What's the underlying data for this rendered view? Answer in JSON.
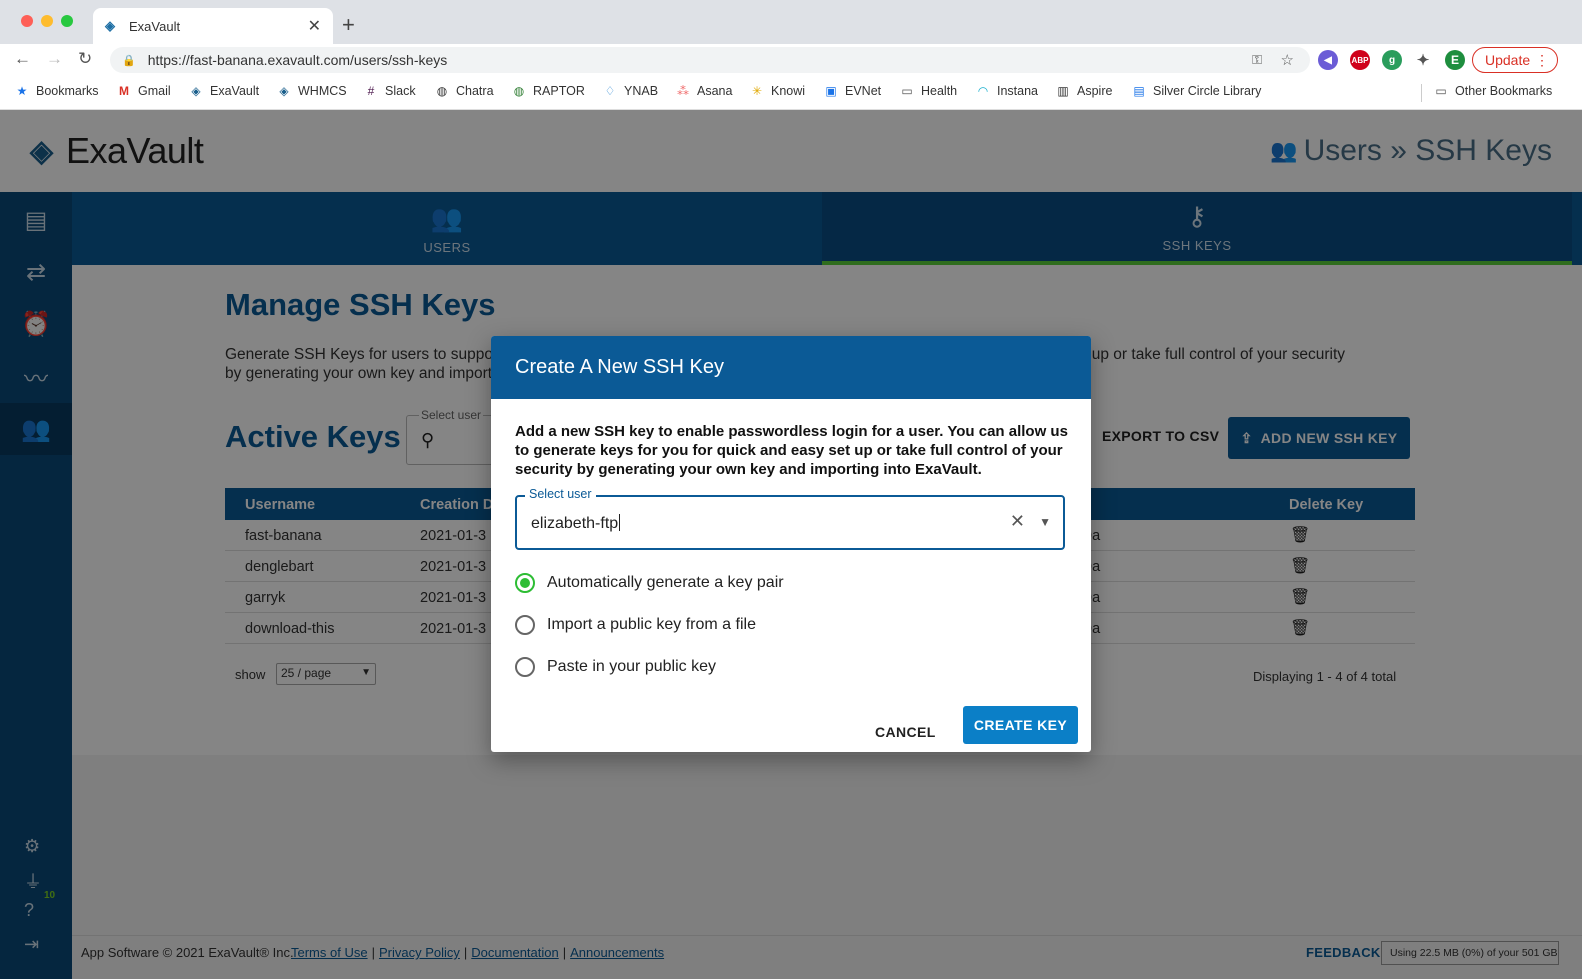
{
  "browser": {
    "tab_title": "ExaVault",
    "url": "https://fast-banana.exavault.com/users/ssh-keys",
    "update_label": "Update",
    "profile_initial": "E",
    "bookmarks": [
      "Bookmarks",
      "Gmail",
      "ExaVault",
      "WHMCS",
      "Slack",
      "Chatra",
      "RAPTOR",
      "YNAB",
      "Asana",
      "Knowi",
      "EVNet",
      "Health",
      "Instana",
      "Aspire",
      "Silver Circle Library"
    ],
    "other_bookmarks": "Other Bookmarks"
  },
  "app": {
    "logo_text": "ExaVault",
    "page_crumb": "Users » SSH Keys"
  },
  "topnav": {
    "users_label": "USERS",
    "sshkeys_label": "SSH KEYS"
  },
  "sidebar": {
    "badge": "10"
  },
  "main": {
    "manage_title": "Manage SSH Keys",
    "manage_desc": "Generate SSH Keys for users to support passwordless login. You can allow us to generate keys for you for quick and easy set up or take full control of your security by generating your own key and importing into ExaVault.",
    "active_title": "Active Keys",
    "search_label": "Select user",
    "export_label": "EXPORT TO CSV",
    "add_key_label": "ADD NEW SSH KEY",
    "table": {
      "headers": [
        "Username",
        "Creation D",
        "Delete Key"
      ],
      "rows": [
        {
          "username": "fast-banana",
          "created": "2021-01-3",
          "fingerprint": ":9a"
        },
        {
          "username": "denglebart",
          "created": "2021-01-3",
          "fingerprint": ":9a"
        },
        {
          "username": "garryk",
          "created": "2021-01-3",
          "fingerprint": ":9a"
        },
        {
          "username": "download-this",
          "created": "2021-01-3",
          "fingerprint": ":9a"
        }
      ]
    },
    "show_label": "show",
    "page_size": "25 / page",
    "displaying": "Displaying 1 - 4 of 4 total"
  },
  "footer": {
    "copyright": "App Software © 2021 ExaVault® Inc.",
    "links": [
      "Terms of Use",
      "Privacy Policy",
      "Documentation",
      "Announcements"
    ],
    "feedback": "FEEDBACK",
    "usage": "Using 22.5 MB (0%) of your 501 GB"
  },
  "modal": {
    "title": "Create A New SSH Key",
    "description": "Add a new SSH key to enable passwordless login for a user. You can allow us to generate keys for you for quick and easy set up or take full control of your security by generating your own key and importing into ExaVault.",
    "select_label": "Select user",
    "select_value": "elizabeth-ftp",
    "options": [
      "Automatically generate a key pair",
      "Import a public key from a file",
      "Paste in your public key"
    ],
    "selected_option": 0,
    "cancel_label": "CANCEL",
    "create_label": "CREATE KEY"
  },
  "colors": {
    "brand_blue": "#0b5a96",
    "active_green": "#2dbd34",
    "primary_button": "#0b7fc7"
  }
}
